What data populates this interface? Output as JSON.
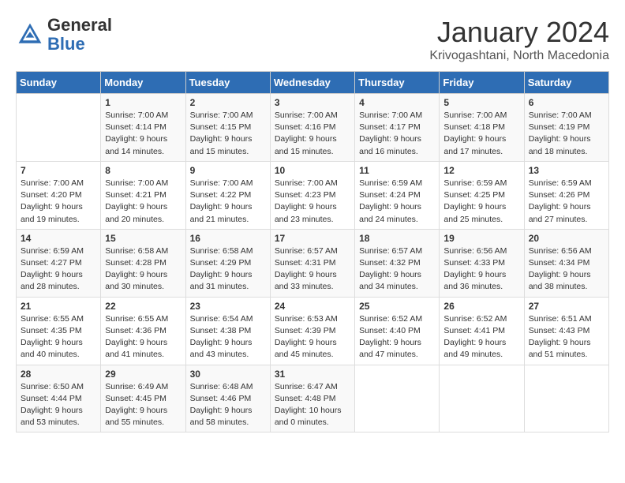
{
  "header": {
    "logo_general": "General",
    "logo_blue": "Blue",
    "month": "January 2024",
    "location": "Krivogashtani, North Macedonia"
  },
  "weekdays": [
    "Sunday",
    "Monday",
    "Tuesday",
    "Wednesday",
    "Thursday",
    "Friday",
    "Saturday"
  ],
  "weeks": [
    [
      {
        "day": "",
        "info": ""
      },
      {
        "day": "1",
        "info": "Sunrise: 7:00 AM\nSunset: 4:14 PM\nDaylight: 9 hours\nand 14 minutes."
      },
      {
        "day": "2",
        "info": "Sunrise: 7:00 AM\nSunset: 4:15 PM\nDaylight: 9 hours\nand 15 minutes."
      },
      {
        "day": "3",
        "info": "Sunrise: 7:00 AM\nSunset: 4:16 PM\nDaylight: 9 hours\nand 15 minutes."
      },
      {
        "day": "4",
        "info": "Sunrise: 7:00 AM\nSunset: 4:17 PM\nDaylight: 9 hours\nand 16 minutes."
      },
      {
        "day": "5",
        "info": "Sunrise: 7:00 AM\nSunset: 4:18 PM\nDaylight: 9 hours\nand 17 minutes."
      },
      {
        "day": "6",
        "info": "Sunrise: 7:00 AM\nSunset: 4:19 PM\nDaylight: 9 hours\nand 18 minutes."
      }
    ],
    [
      {
        "day": "7",
        "info": "Sunrise: 7:00 AM\nSunset: 4:20 PM\nDaylight: 9 hours\nand 19 minutes."
      },
      {
        "day": "8",
        "info": "Sunrise: 7:00 AM\nSunset: 4:21 PM\nDaylight: 9 hours\nand 20 minutes."
      },
      {
        "day": "9",
        "info": "Sunrise: 7:00 AM\nSunset: 4:22 PM\nDaylight: 9 hours\nand 21 minutes."
      },
      {
        "day": "10",
        "info": "Sunrise: 7:00 AM\nSunset: 4:23 PM\nDaylight: 9 hours\nand 23 minutes."
      },
      {
        "day": "11",
        "info": "Sunrise: 6:59 AM\nSunset: 4:24 PM\nDaylight: 9 hours\nand 24 minutes."
      },
      {
        "day": "12",
        "info": "Sunrise: 6:59 AM\nSunset: 4:25 PM\nDaylight: 9 hours\nand 25 minutes."
      },
      {
        "day": "13",
        "info": "Sunrise: 6:59 AM\nSunset: 4:26 PM\nDaylight: 9 hours\nand 27 minutes."
      }
    ],
    [
      {
        "day": "14",
        "info": "Sunrise: 6:59 AM\nSunset: 4:27 PM\nDaylight: 9 hours\nand 28 minutes."
      },
      {
        "day": "15",
        "info": "Sunrise: 6:58 AM\nSunset: 4:28 PM\nDaylight: 9 hours\nand 30 minutes."
      },
      {
        "day": "16",
        "info": "Sunrise: 6:58 AM\nSunset: 4:29 PM\nDaylight: 9 hours\nand 31 minutes."
      },
      {
        "day": "17",
        "info": "Sunrise: 6:57 AM\nSunset: 4:31 PM\nDaylight: 9 hours\nand 33 minutes."
      },
      {
        "day": "18",
        "info": "Sunrise: 6:57 AM\nSunset: 4:32 PM\nDaylight: 9 hours\nand 34 minutes."
      },
      {
        "day": "19",
        "info": "Sunrise: 6:56 AM\nSunset: 4:33 PM\nDaylight: 9 hours\nand 36 minutes."
      },
      {
        "day": "20",
        "info": "Sunrise: 6:56 AM\nSunset: 4:34 PM\nDaylight: 9 hours\nand 38 minutes."
      }
    ],
    [
      {
        "day": "21",
        "info": "Sunrise: 6:55 AM\nSunset: 4:35 PM\nDaylight: 9 hours\nand 40 minutes."
      },
      {
        "day": "22",
        "info": "Sunrise: 6:55 AM\nSunset: 4:36 PM\nDaylight: 9 hours\nand 41 minutes."
      },
      {
        "day": "23",
        "info": "Sunrise: 6:54 AM\nSunset: 4:38 PM\nDaylight: 9 hours\nand 43 minutes."
      },
      {
        "day": "24",
        "info": "Sunrise: 6:53 AM\nSunset: 4:39 PM\nDaylight: 9 hours\nand 45 minutes."
      },
      {
        "day": "25",
        "info": "Sunrise: 6:52 AM\nSunset: 4:40 PM\nDaylight: 9 hours\nand 47 minutes."
      },
      {
        "day": "26",
        "info": "Sunrise: 6:52 AM\nSunset: 4:41 PM\nDaylight: 9 hours\nand 49 minutes."
      },
      {
        "day": "27",
        "info": "Sunrise: 6:51 AM\nSunset: 4:43 PM\nDaylight: 9 hours\nand 51 minutes."
      }
    ],
    [
      {
        "day": "28",
        "info": "Sunrise: 6:50 AM\nSunset: 4:44 PM\nDaylight: 9 hours\nand 53 minutes."
      },
      {
        "day": "29",
        "info": "Sunrise: 6:49 AM\nSunset: 4:45 PM\nDaylight: 9 hours\nand 55 minutes."
      },
      {
        "day": "30",
        "info": "Sunrise: 6:48 AM\nSunset: 4:46 PM\nDaylight: 9 hours\nand 58 minutes."
      },
      {
        "day": "31",
        "info": "Sunrise: 6:47 AM\nSunset: 4:48 PM\nDaylight: 10 hours\nand 0 minutes."
      },
      {
        "day": "",
        "info": ""
      },
      {
        "day": "",
        "info": ""
      },
      {
        "day": "",
        "info": ""
      }
    ]
  ]
}
